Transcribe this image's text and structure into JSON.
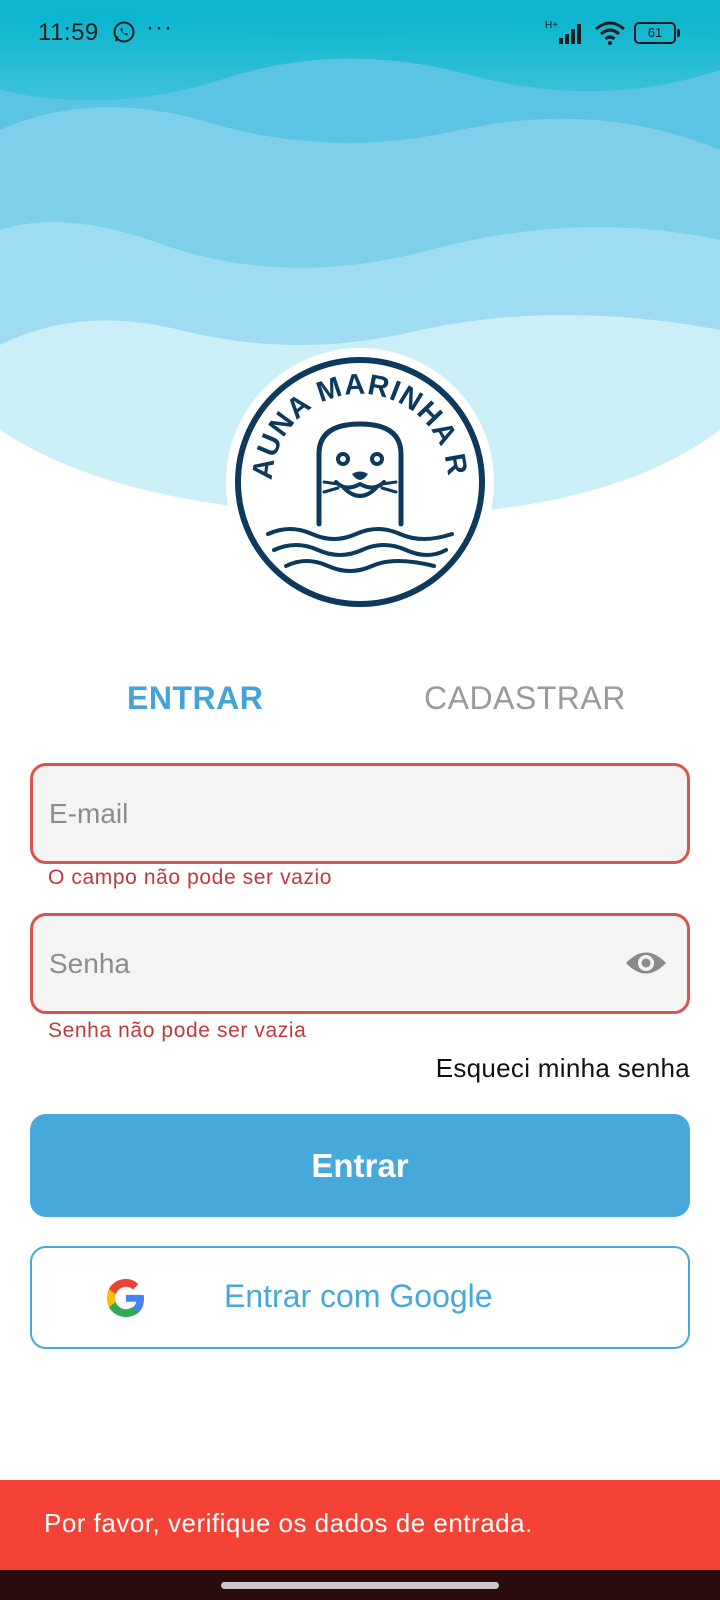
{
  "status_bar": {
    "time": "11:59",
    "dots": "···",
    "network_label": "H+",
    "battery": "61"
  },
  "logo": {
    "text": "FAUNA MARINHA RS",
    "icon": "seal-logo-icon"
  },
  "tabs": {
    "login": "ENTRAR",
    "register": "CADASTRAR"
  },
  "form": {
    "email_placeholder": "E-mail",
    "email_error": "O campo não pode ser vazio",
    "password_placeholder": "Senha",
    "password_error": "Senha não pode ser vazia",
    "forgot_password": "Esqueci minha senha"
  },
  "buttons": {
    "login": "Entrar",
    "google": "Entrar com Google"
  },
  "snackbar": {
    "message": "Por favor, verifique os dados de entrada."
  },
  "colors": {
    "accent": "#47a9da",
    "error": "#d9534f",
    "snackbar": "#f44336",
    "logo_navy": "#0d3a5c"
  }
}
